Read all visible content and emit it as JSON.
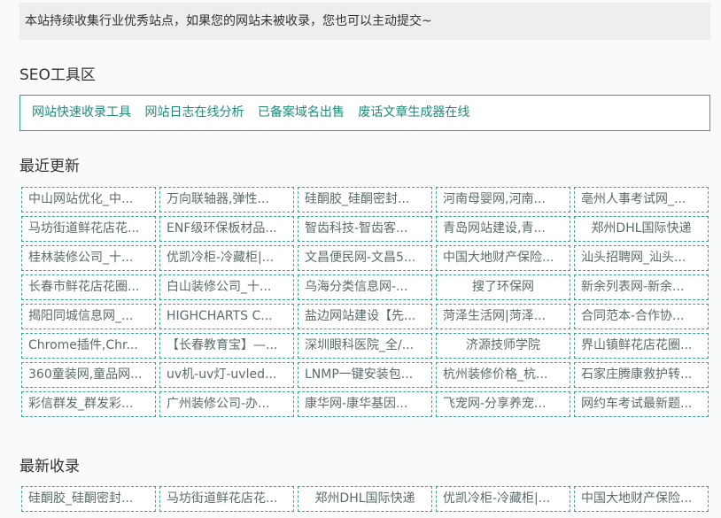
{
  "notice": "本站持续收集行业优秀站点，如果您的网站未被收录，您也可以主动提交~",
  "seo_tools": {
    "title": "SEO工具区",
    "links": [
      "网站快速收录工具",
      "网站日志在线分析",
      "已备案域名出售",
      "废话文章生成器在线"
    ]
  },
  "recent_updates": {
    "title": "最近更新",
    "items": [
      "中山网站优化_中...",
      "万向联轴器,弹性...",
      "硅酮胶_硅酮密封...",
      "河南母婴网,河南...",
      "亳州人事考试网_...",
      "马坊街道鲜花店花...",
      "ENF级环保板材品...",
      "智齿科技-智齿客...",
      "青岛网站建设,青...",
      "郑州DHL国际快递",
      "桂林装修公司_十...",
      "优凯冷柜-冷藏柜|...",
      "文昌便民网-文昌5...",
      "中国大地财产保险...",
      "汕头招聘网_汕头...",
      "长春市鲜花店花圈...",
      "白山装修公司_十...",
      "乌海分类信息网-...",
      "搜了环保网",
      "新余列表网-新余...",
      "揭阳同城信息网_...",
      "HIGHCHARTS C...",
      "盐边网站建设【先...",
      "菏泽生活网|菏泽...",
      "合同范本-合作协...",
      "Chrome插件,Chr...",
      "【长春教育宝】—...",
      "深圳眼科医院_全/...",
      "济源技师学院",
      "界山镇鲜花店花圈...",
      "360童装网,童品网...",
      "uv机-uv灯-uvled...",
      "LNMP一键安装包...",
      "杭州装修价格_杭...",
      "石家庄腾康救护转...",
      "彩信群发_群发彩...",
      "广州装修公司-办...",
      "康华网-康华基因...",
      "飞宠网-分享养宠...",
      "网约车考试最新题..."
    ]
  },
  "latest_included": {
    "title": "最新收录",
    "items": [
      "硅酮胶_硅酮密封...",
      "马坊街道鲜花店花...",
      "郑州DHL国际快递",
      "优凯冷柜-冷藏柜|...",
      "中国大地财产保险..."
    ]
  }
}
